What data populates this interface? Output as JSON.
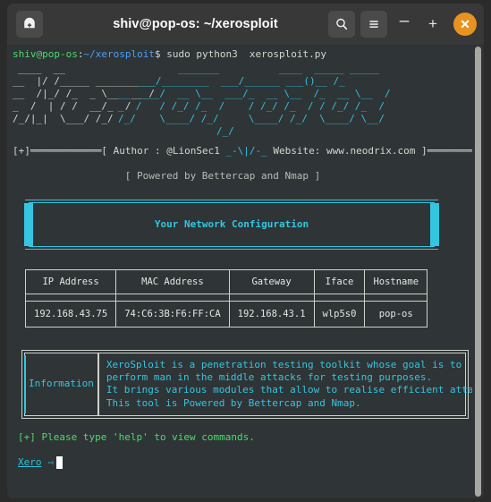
{
  "titlebar": {
    "new_tab_icon": "new-terminal-icon",
    "title": "shiv@pop-os: ~/xerosploit",
    "search_icon": "search-icon",
    "menu_icon": "hamburger-menu-icon",
    "minimize_label": "–",
    "maximize_label": "+",
    "close_label": "✕",
    "accent_close": "#e8931f"
  },
  "terminal": {
    "prompt": {
      "user_host": "shiv@pop-os",
      "colon": ":",
      "path": "~/xerosploit",
      "dollar": "$",
      "command": " sudo python3  xerosploit.py"
    },
    "banner": {
      "white_lines": [
        "____  __",
        "__  |/ /_____ __________",
        "__  /|_/ /_  _ \\__  ___/",
        "_  /  | / /  __/_  /",
        "/_/|_|  \\___/ /_/"
      ],
      "cyan_lines": [
        "_______          ____  _____ _____",
        "___/________  ___/______ ___()__ /_",
        "__  ___/  __ \\__  ___/_  __ \\__  /_  __ \\__  /",
        "_  /   / /_/ /_  /    / /_/ /_  / / /_/ /_  /",
        "/_/    \\____/ /_/     \\____/ /_/  \\____/ \\__/",
        "/_/"
      ]
    },
    "author_line": {
      "left_bracket": "[+]",
      "rule": "════════════",
      "text_pre": "[ Author : @LionSec1 ",
      "decoration": "_-\\|/-_",
      "text_post": " Website: www.neodrix.com ]",
      "right_bracket": "[+]"
    },
    "powered_by": "[ Powered by Bettercap and Nmap ]",
    "network_config_title": "Your Network Configuration",
    "table": {
      "headers": [
        "IP Address",
        "MAC Address",
        "Gateway",
        "Iface",
        "Hostname"
      ],
      "rows": [
        [
          "192.168.43.75",
          "74:C6:3B:F6:FF:CA",
          "192.168.43.1",
          "wlp5s0",
          "pop-os"
        ]
      ]
    },
    "info_box": {
      "label": "Information",
      "text": "XeroSploit is a penetration testing toolkit whose goal is to\nperform man in the middle attacks for testing purposes.\nIt brings various modules that allow to realise efficient attacks.\nThis tool is Powered by Bettercap and Nmap."
    },
    "help_line": "[+] Please type 'help' to view commands.",
    "xero_prompt": {
      "name": "Xero",
      "arrow": "⇨",
      "cursor": ""
    },
    "colors": {
      "background": "#2f3436",
      "cyan": "#34c6e0",
      "green": "#4ddb6e",
      "blue": "#4a9ff5",
      "foreground": "#d3d7cf"
    }
  }
}
